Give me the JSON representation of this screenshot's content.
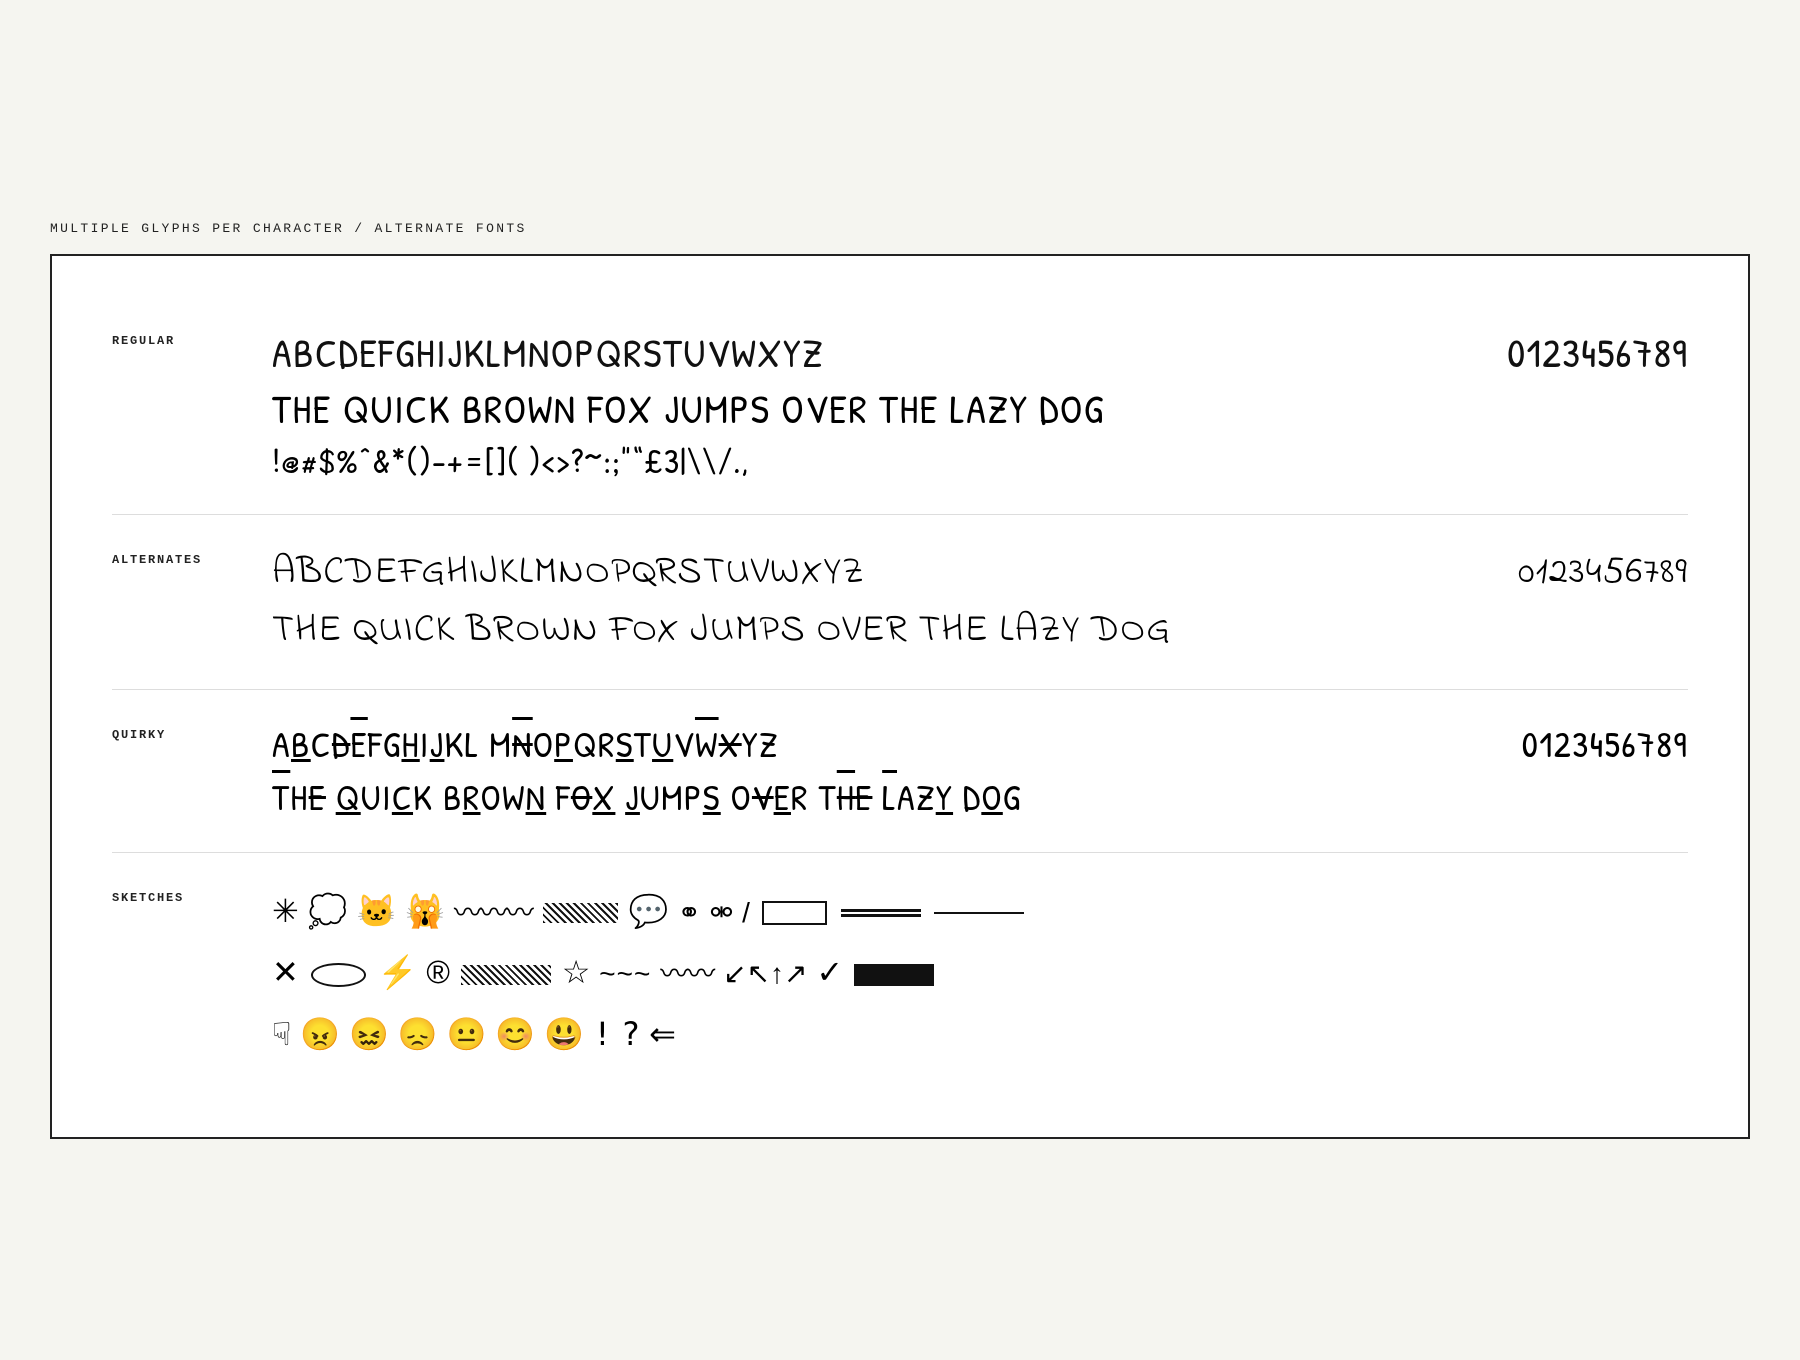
{
  "page": {
    "title": "MULTIPLE GLYPHS PER CHARACTER / ALTERNATE FONTS"
  },
  "rows": {
    "regular": {
      "label": "REGULAR",
      "line1_alpha": "ABCDEFGHIJKLMNOPQRSTUVWXYZ",
      "line1_nums": "0123456789",
      "line2": "THE QUICK BROWN FOX JUMPS OVER THE LAZY DOG",
      "line3": "!@#$%^&*()-+=[](}<>?~:;\"\"£3|\\/.,",
      "line3_display": "!@#$%^&*()-+=[](}<>?~:;\"\"£3|\\/.,,"
    },
    "alternates": {
      "label": "ALTERNATES",
      "line1_alpha": "ABCDEFGHIJKLMNOPQRSTUVWXYZ",
      "line1_nums": "0123456789",
      "line2": "THE QUICK BROWN FOX JUMPS OVER THE LAZY DOG"
    },
    "quirky": {
      "label": "QUIRKY",
      "line1_nums": "0123456789",
      "line2": "THE QUICK BROWN FOX JUMPS OVER THE LAZY DOG"
    },
    "sketches": {
      "label": "SKETCHES",
      "line1": "* ☁ 😸 😿 ∿∿∿",
      "line2": "× ⊂⊃ ⚡ ® ——— ☆ ~~~",
      "line3": "☟ 😠 😖 😞 😐 😊 😃 !?⇐"
    }
  }
}
